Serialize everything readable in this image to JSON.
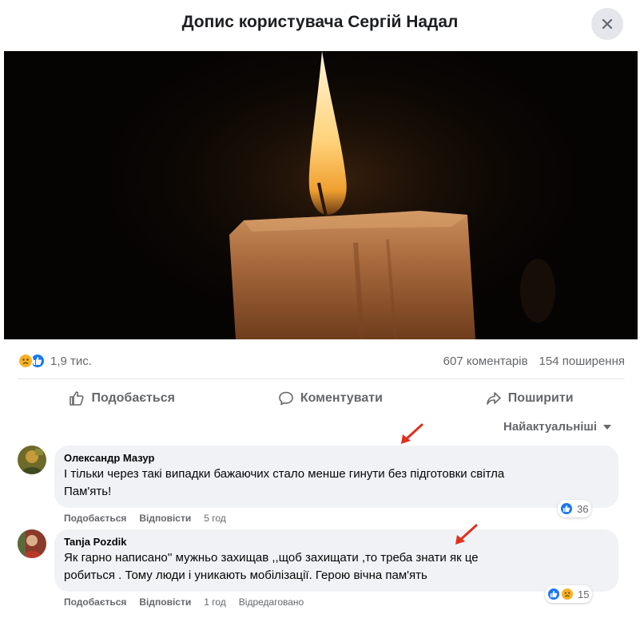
{
  "header": {
    "title": "Допис користувача Сергій Надал"
  },
  "icons": {
    "close": "close-icon",
    "like": "like-icon",
    "comment": "comment-icon",
    "share": "share-icon",
    "sort": "caret-down-icon"
  },
  "post": {
    "reactions_count": "1,9 тис.",
    "comments_count": "607 коментарів",
    "shares_count": "154 поширення"
  },
  "actions": {
    "like": "Подобається",
    "comment": "Коментувати",
    "share": "Поширити"
  },
  "sort": {
    "label": "Найактуальніші"
  },
  "comments": [
    {
      "author": "Олександр Мазур",
      "lines": [
        "І тільки через такі випадки бажаючих стало менше гинути без підготовки світла",
        "Пам'ять!"
      ],
      "like": "Подобається",
      "reply": "Відповісти",
      "time": "5 год",
      "reactions": "36"
    },
    {
      "author": "Tanja Pozdik",
      "lines": [
        "Як гарно написано'' мужньо захищав ,,щоб захищати ,то треба знати як це",
        "робиться . Тому люди і уникають мобілізації. Герою вічна пам'ять"
      ],
      "like": "Подобається",
      "reply": "Відповісти",
      "time": "1 год",
      "edited": "Відредаговано",
      "reactions": "15"
    }
  ],
  "colors": {
    "accent": "#1877f2",
    "sad": "#f7b125",
    "bubble": "#f0f2f5",
    "annotation_arrow": "#e0301e"
  }
}
